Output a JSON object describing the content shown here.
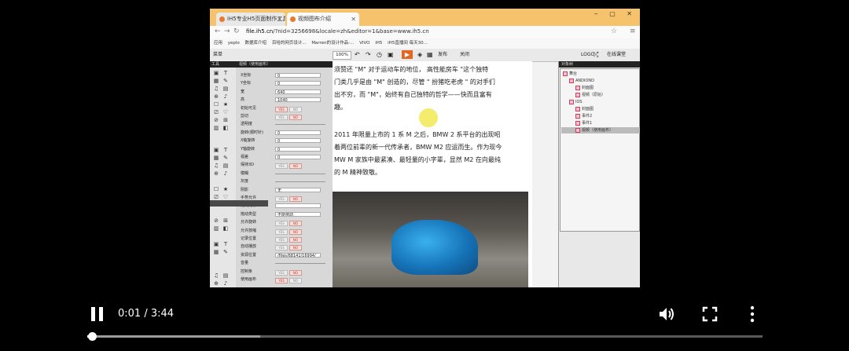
{
  "browser": {
    "tabs": [
      {
        "label": "iH5专业H5页面制作工具"
      },
      {
        "label": "视频图布介绍"
      }
    ],
    "window_controls": "‒ ▢ ✕",
    "url_host": "file.ih5.cn",
    "url_path": "/?nid=3256698&locale=zh&editor=1&base=www.ih5.cn",
    "bookmarks": [
      "应用",
      "yeplo",
      "数据库介绍",
      "百哈的网页设计...",
      "Marren的设计作品-...",
      "VIVO",
      "iH5",
      "iH5直播间 每天30..."
    ]
  },
  "editor_toolbar": {
    "menu": "菜单",
    "zoom": "100%",
    "publish": "发布",
    "close": "关闭",
    "logo": "LOGO",
    "online_class": "在线课堂"
  },
  "tools_panel": {
    "header": "工具"
  },
  "properties_panel": {
    "header": "视频（使用画布）",
    "rows": [
      {
        "label": "X坐标",
        "value": "0"
      },
      {
        "label": "Y坐标",
        "value": "0"
      },
      {
        "label": "宽",
        "value": "640"
      },
      {
        "label": "高",
        "value": "1040"
      },
      {
        "label": "初始可见",
        "toggle": "YES"
      },
      {
        "label": "剪切",
        "toggle": "NO"
      },
      {
        "label": "透明度",
        "slider": true
      },
      {
        "label": "旋转(顺时针)",
        "value": "0"
      },
      {
        "label": "X轴旋转",
        "value": "0"
      },
      {
        "label": "Y轴旋转",
        "value": "0"
      },
      {
        "label": "视差",
        "value": "0"
      },
      {
        "label": "保持3D",
        "toggle": "NO"
      },
      {
        "label": "模糊",
        "slider": true
      },
      {
        "label": "灰度",
        "slider": true
      },
      {
        "label": "阴影",
        "value": "无"
      },
      {
        "label": "手势允许",
        "toggle": "NO"
      },
      {
        "label": "定制光标",
        "value": ""
      },
      {
        "label": "拖动类型",
        "value": "不能拖动"
      },
      {
        "label": "允许旋转",
        "toggle": "NO"
      },
      {
        "label": "允许放缩",
        "toggle": "NO"
      },
      {
        "label": "记录位置",
        "toggle": "NO"
      },
      {
        "label": "自动播放",
        "toggle": "NO"
      },
      {
        "label": "资源位置",
        "value": "/files/68141/16994/"
      },
      {
        "label": "音量",
        "slider": true
      },
      {
        "label": "控制条",
        "toggle": "NO"
      },
      {
        "label": "使用画布",
        "toggle": "YES"
      }
    ]
  },
  "canvas": {
    "lines": [
      "须赞还 \"M\" 对于运动车的地位， 高性能房车 \"这个独特",
      "门类几乎是由 \"M\" 创造的，尽管 \" 扮猪吃老虎 \" 的对手们",
      "出不穷，而 \"M\"，始终有自己独特的哲学——快而且富有",
      "趣。",
      "2011 年限量上市的 1 系 M 之后，BMW 2 系平台的出现昭",
      "着两位前辈的新一代传承者，BMW M2 应运而生。作为现今",
      "MW M 家族中最紧凑、最轻量的小字辈，显然 M2 在向最纯",
      "的 M 精神致敬。"
    ]
  },
  "scene_tree": {
    "header": "对象树",
    "nodes": [
      {
        "label": "舞台",
        "depth": 0
      },
      {
        "label": "ANDIOND",
        "depth": 1
      },
      {
        "label": "封面图",
        "depth": 2
      },
      {
        "label": "视频（原始）",
        "depth": 2
      },
      {
        "label": "IOS",
        "depth": 1
      },
      {
        "label": "封面图",
        "depth": 2
      },
      {
        "label": "事件2",
        "depth": 2
      },
      {
        "label": "事件1",
        "depth": 2
      },
      {
        "label": "视频（使用画布）",
        "depth": 2,
        "selected": true
      }
    ]
  },
  "player": {
    "current_time": "0:01",
    "duration": "3:44",
    "time_display": "0:01 / 3:44",
    "progress": 0.004,
    "buffered": 0.256
  }
}
